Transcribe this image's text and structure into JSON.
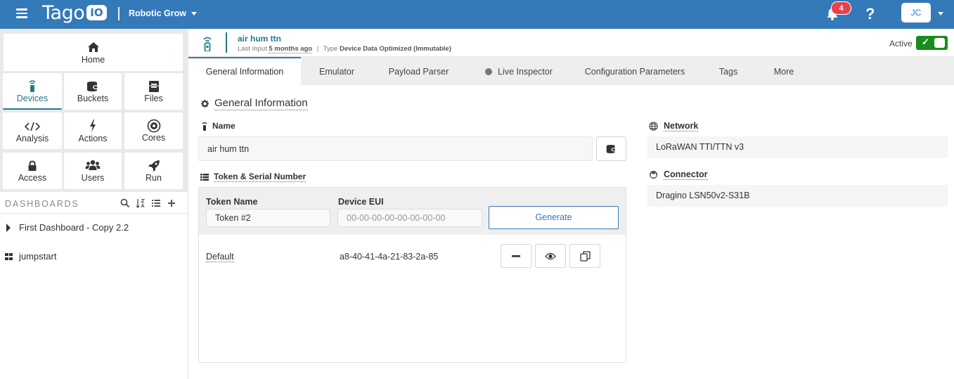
{
  "topbar": {
    "logo_text": "Tago",
    "logo_badge": "IO",
    "account_name": "Robotic Grow",
    "notification_count": "4",
    "help_label": "?",
    "user_initials": "JC"
  },
  "sidebar": {
    "nav": [
      {
        "label": "Home",
        "icon": "home-icon"
      },
      {
        "label": "Devices",
        "icon": "device-icon"
      },
      {
        "label": "Buckets",
        "icon": "bucket-icon"
      },
      {
        "label": "Files",
        "icon": "files-icon"
      },
      {
        "label": "Analysis",
        "icon": "code-icon"
      },
      {
        "label": "Actions",
        "icon": "bolt-icon"
      },
      {
        "label": "Cores",
        "icon": "cores-icon"
      },
      {
        "label": "Access",
        "icon": "lock-icon"
      },
      {
        "label": "Users",
        "icon": "users-icon"
      },
      {
        "label": "Run",
        "icon": "rocket-icon"
      }
    ],
    "active": "Devices",
    "dashboards_title": "DASHBOARDS",
    "dashboards": [
      {
        "label": "First Dashboard - Copy 2.2",
        "icon": "caret-right-icon"
      },
      {
        "label": "jumpstart",
        "icon": "grid-icon"
      }
    ]
  },
  "device": {
    "name": "air hum ttn",
    "last_input_label": "Last Input",
    "last_input_value": "5 months ago",
    "separator": "|",
    "type_label": "Type",
    "type_value": "Device Data Optimized (Immutable)",
    "active_label": "Active",
    "active": true
  },
  "tabs": [
    {
      "label": "General Information",
      "active": true
    },
    {
      "label": "Emulator"
    },
    {
      "label": "Payload Parser"
    },
    {
      "label": "Live Inspector",
      "status_dot": "#777777"
    },
    {
      "label": "Configuration Parameters"
    },
    {
      "label": "Tags"
    },
    {
      "label": "More"
    }
  ],
  "general": {
    "section_title": "General Information",
    "name_label": "Name",
    "name_value": "air hum ttn",
    "token_section_label": "Token & Serial Number",
    "token_name_label": "Token Name",
    "token_name_value": "Token #2",
    "device_eui_label": "Device EUI",
    "device_eui_placeholder": "00-00-00-00-00-00-00-00",
    "generate_label": "Generate",
    "tokens": [
      {
        "name": "Default",
        "serial": "a8-40-41-4a-21-83-2a-85"
      }
    ],
    "network_label": "Network",
    "network_value": "LoRaWAN TTI/TTN v3",
    "connector_label": "Connector",
    "connector_value": "Dragino LSN50v2-S31B"
  },
  "colors": {
    "topbar": "#3479b8",
    "accent_teal": "#237a8c",
    "toggle_green": "#198c1e",
    "badge_red": "#e8434b"
  }
}
